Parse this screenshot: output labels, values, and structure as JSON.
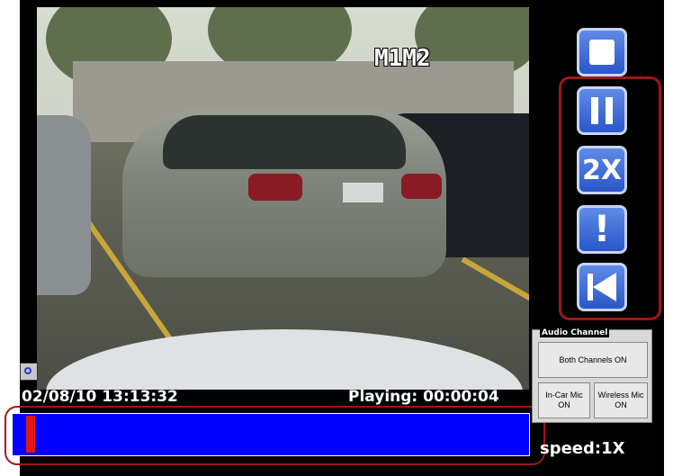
{
  "video": {
    "camera_label": "M1M2",
    "timestamp": "02/08/10 13:13:32",
    "playing_status": "Playing: 00:00:04"
  },
  "playback": {
    "progress_fraction": 0.02,
    "speed": "speed:1X"
  },
  "controls": {
    "stop_icon": "stop-icon",
    "pause_icon": "pause-icon",
    "speed_label": "2X",
    "mark_label": "!",
    "rewind_icon": "rewind-icon"
  },
  "audio": {
    "title": "Audio Channel",
    "both_label": "Both Channels ON",
    "incar_label": "In-Car Mic ON",
    "wireless_label": "Wireless Mic ON"
  },
  "colors": {
    "button": "#2a56c9",
    "timeline": "#0000ff",
    "playhead": "#e01717",
    "highlight": "#a01616"
  }
}
